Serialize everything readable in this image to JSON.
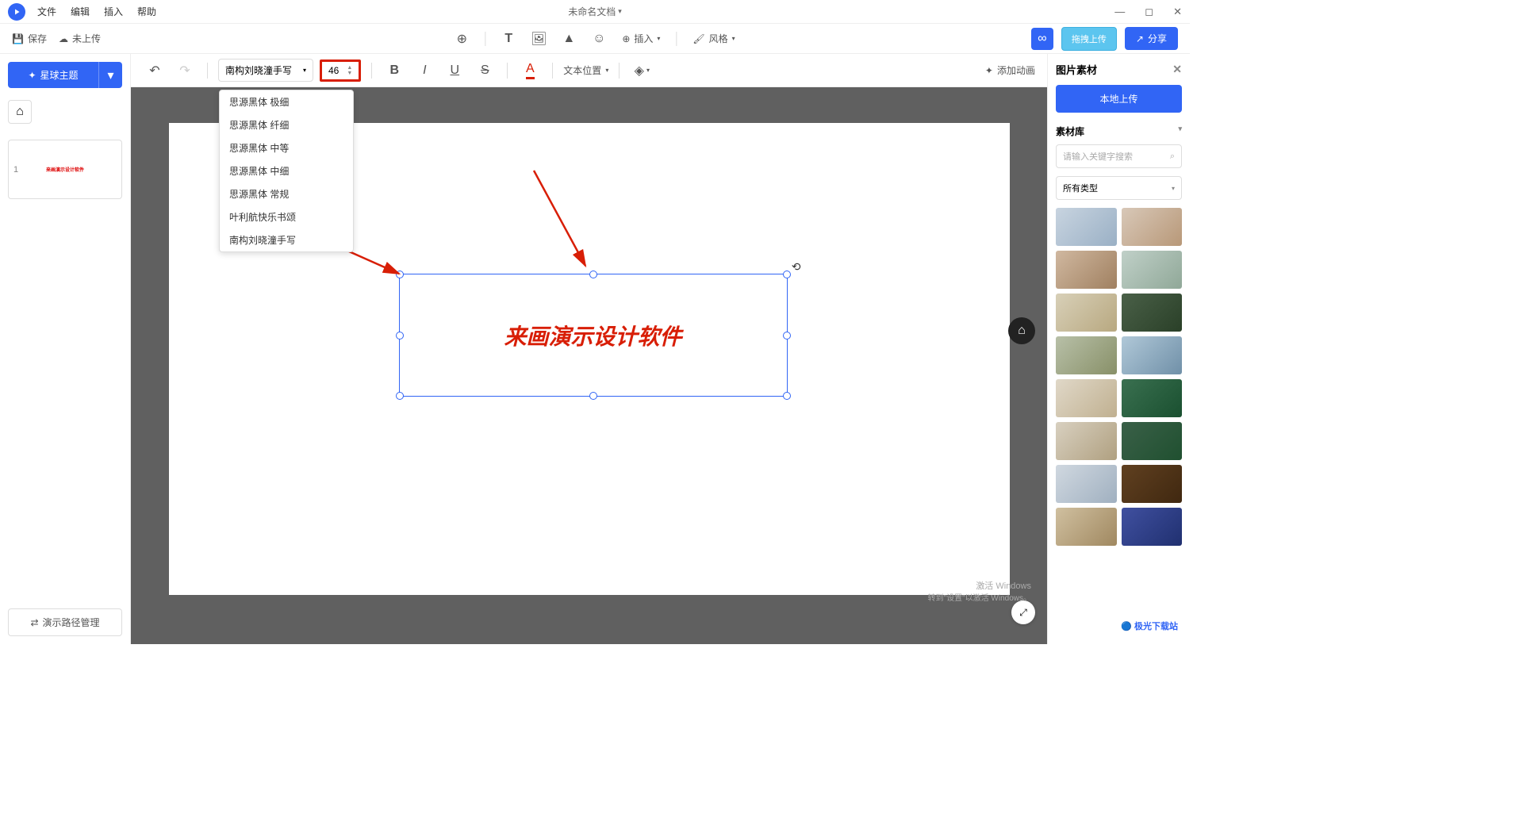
{
  "titlebar": {
    "menu": [
      "文件",
      "编辑",
      "插入",
      "帮助"
    ],
    "doctitle": "未命名文档"
  },
  "toolbar2": {
    "save": "保存",
    "unsaved": "未上传",
    "insert": "插入",
    "style": "风格",
    "drag_upload": "拖拽上传",
    "share": "分享"
  },
  "sidebar": {
    "theme": "星球主题",
    "slide_num": "1",
    "path_mgmt": "演示路径管理"
  },
  "formatbar": {
    "font": "南构刘晓潼手写",
    "size": "46",
    "fonts": [
      "思源黑体 极细",
      "思源黑体 纤细",
      "思源黑体 中等",
      "思源黑体 中细",
      "思源黑体 常规",
      "叶利航快乐书颂",
      "南构刘晓潼手写"
    ],
    "text_pos": "文本位置",
    "add_anim": "添加动画"
  },
  "canvas": {
    "textbox": "来画演示设计软件"
  },
  "rightpanel": {
    "title": "图片素材",
    "local_upload": "本地上传",
    "library": "素材库",
    "search_placeholder": "请输入关键字搜索",
    "all_types": "所有类型"
  },
  "watermark": {
    "line1": "激活 Windows",
    "line2": "转到\"设置\"以激活 Windows。"
  },
  "site": "极光下载站"
}
